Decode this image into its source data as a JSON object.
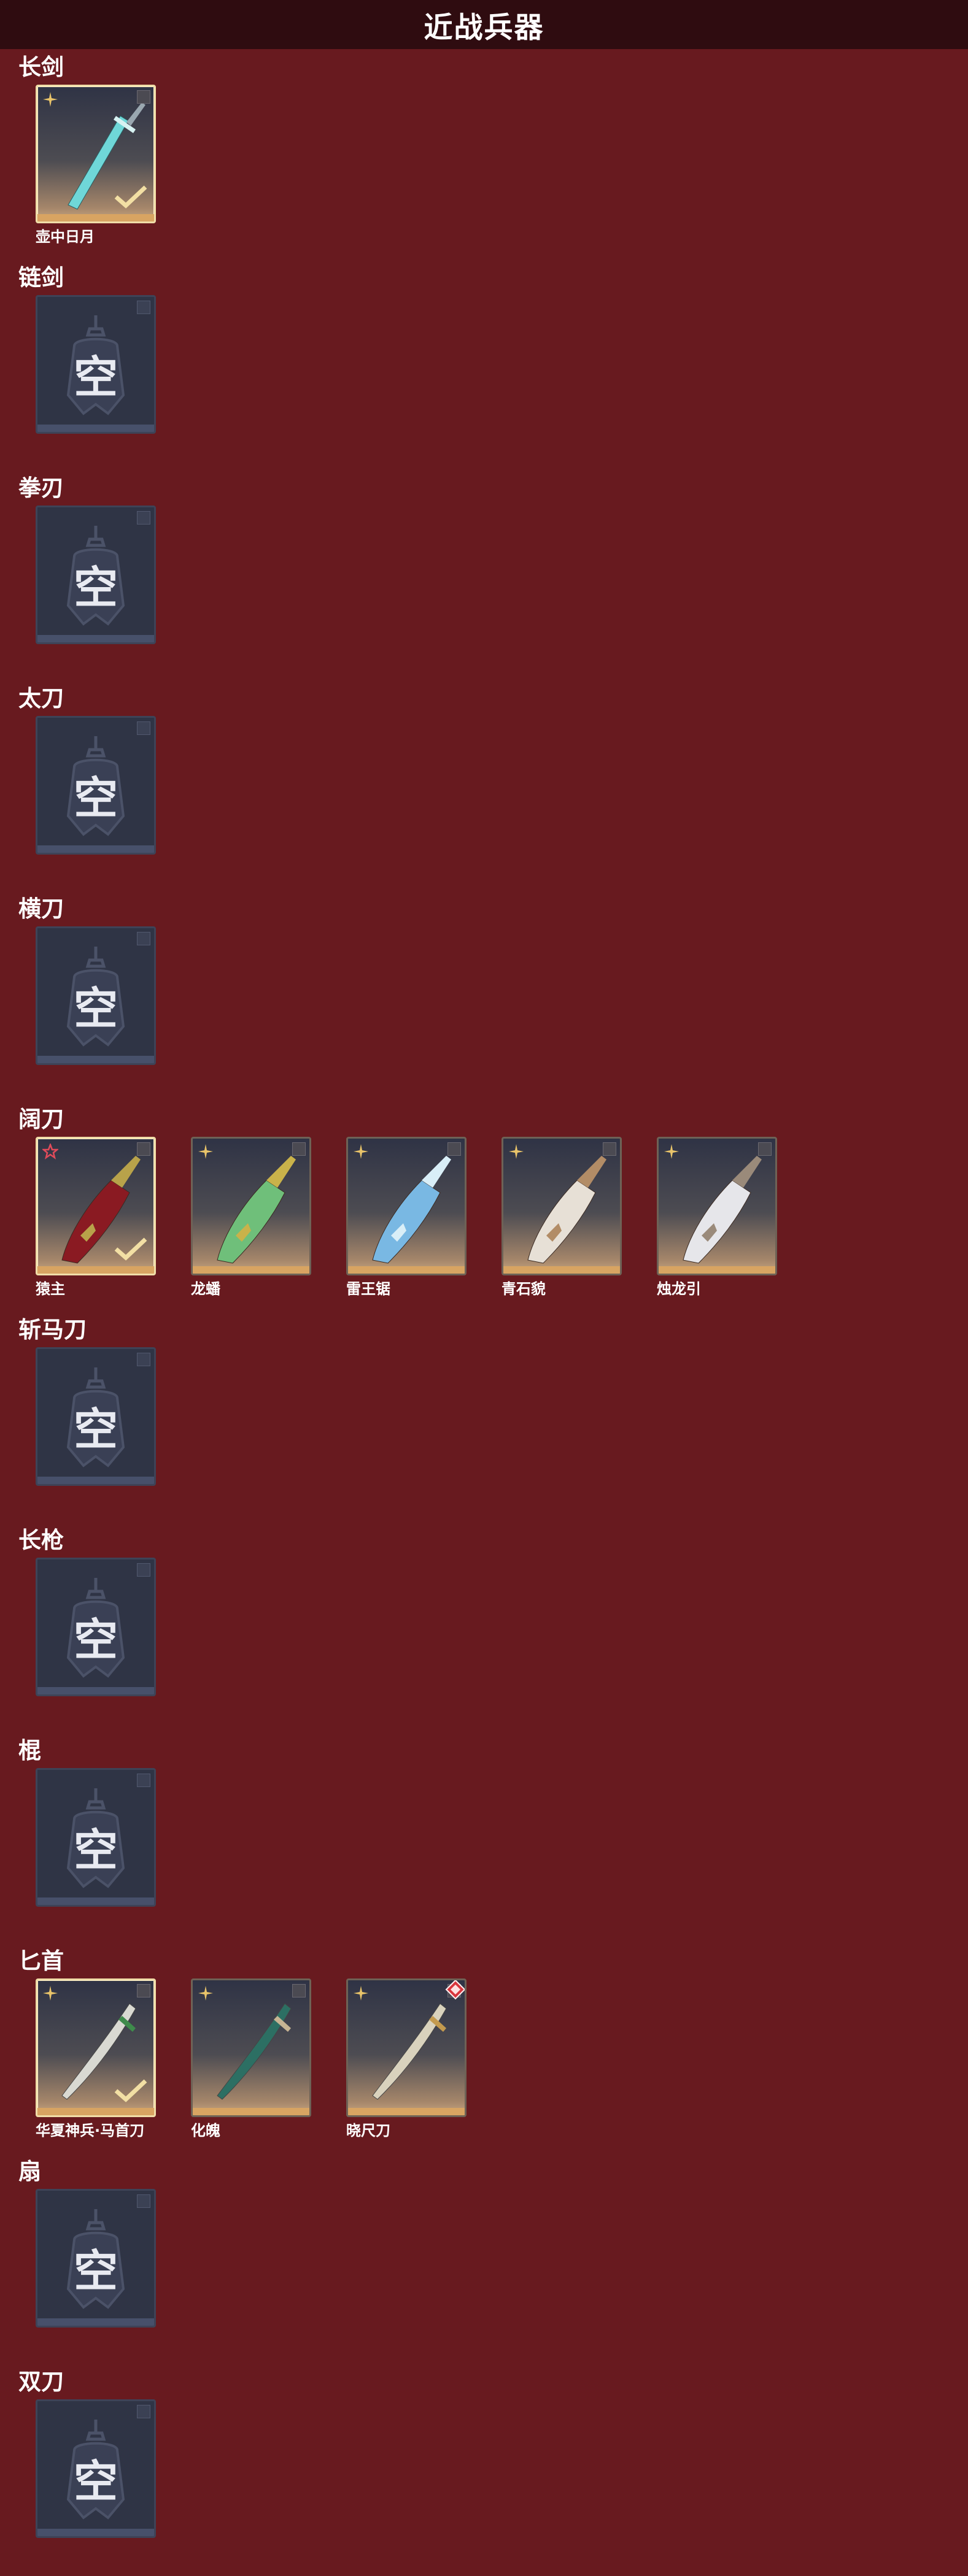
{
  "header": {
    "title": "近战兵器"
  },
  "empty_slot_label": "空",
  "colors": {
    "page_bg": "#681a1f",
    "header_bg": "#2f0c10",
    "frame_selected": "#f0dda8",
    "gold_bar": "#d8a462",
    "empty_card": "#2f3445",
    "grade_gold": "#e9c46a",
    "grade_red": "#e24b5a"
  },
  "categories": [
    {
      "name": "长剑",
      "items": [
        {
          "name": "壶中日月",
          "selected": true,
          "grade": "gold",
          "weapon": "straight-sword"
        }
      ]
    },
    {
      "name": "链剑",
      "items": []
    },
    {
      "name": "拳刃",
      "items": []
    },
    {
      "name": "太刀",
      "items": []
    },
    {
      "name": "横刀",
      "items": []
    },
    {
      "name": "阔刀",
      "items": [
        {
          "name": "猿主",
          "selected": true,
          "grade": "red",
          "weapon": "broadblade-red"
        },
        {
          "name": "龙蟠",
          "selected": false,
          "grade": "gold",
          "weapon": "broadblade-green"
        },
        {
          "name": "雷王锯",
          "selected": false,
          "grade": "gold",
          "weapon": "broadblade-blue"
        },
        {
          "name": "青石貌",
          "selected": false,
          "grade": "gold",
          "weapon": "broadblade-white"
        },
        {
          "name": "烛龙引",
          "selected": false,
          "grade": "gold",
          "weapon": "broadblade-silver"
        }
      ]
    },
    {
      "name": "斩马刀",
      "items": []
    },
    {
      "name": "长枪",
      "items": []
    },
    {
      "name": "棍",
      "items": []
    },
    {
      "name": "匕首",
      "items": [
        {
          "name": "华夏神兵·马首刀",
          "selected": true,
          "grade": "gold",
          "weapon": "dagger-curved"
        },
        {
          "name": "化魄",
          "selected": false,
          "grade": "gold",
          "weapon": "dagger-hook"
        },
        {
          "name": "晓尺刀",
          "selected": false,
          "grade": "gold",
          "weapon": "dagger-gold",
          "badge": "red-diamond-icon"
        }
      ]
    },
    {
      "name": "扇",
      "items": []
    },
    {
      "name": "双刀",
      "items": []
    }
  ]
}
